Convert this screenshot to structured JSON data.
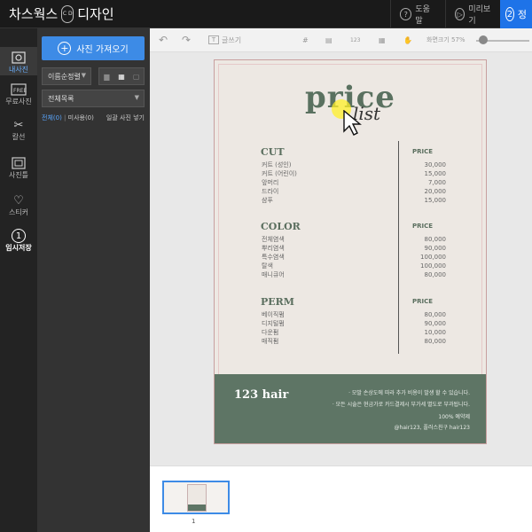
{
  "app": {
    "logo_text": "차스웍스",
    "logo_badge": "C D",
    "logo_suffix": "디자인"
  },
  "topbar": {
    "help_label": "도움말",
    "preview_label": "미리보기",
    "step_number": "2",
    "step_label": "정"
  },
  "rail": {
    "items": [
      {
        "label": "내사진",
        "icon": "photo-icon"
      },
      {
        "label": "무료사진",
        "icon": "free-photo-icon"
      },
      {
        "label": "칼선",
        "icon": "scissors-icon"
      },
      {
        "label": "사진틀",
        "icon": "frame-icon"
      },
      {
        "label": "스티커",
        "icon": "heart-icon"
      },
      {
        "label": "임시저장",
        "icon": "temp-save-icon",
        "number": "1"
      }
    ]
  },
  "panel": {
    "import_button": "사진 가져오기",
    "sort_select": "이름순정렬",
    "folder_select": "전체목록",
    "filter_all": "전체(0)",
    "filter_used": "미사용(0)",
    "filter_bulk": "일괄 사진 넣기"
  },
  "toolbar": {
    "text_tool": "글쓰기",
    "zoom_label": "화면크기 57%",
    "zoom_value": 57
  },
  "document": {
    "title": "price",
    "subtitle": "list",
    "sections": [
      {
        "name": "CUT",
        "price_header": "PRICE",
        "items": [
          {
            "name": "커트 (성인)",
            "price": "30,000"
          },
          {
            "name": "커트 (어린이)",
            "price": "15,000"
          },
          {
            "name": "앞머리",
            "price": "7,000"
          },
          {
            "name": "드라이",
            "price": "20,000"
          },
          {
            "name": "샴푸",
            "price": "15,000"
          }
        ]
      },
      {
        "name": "COLOR",
        "price_header": "PRICE",
        "items": [
          {
            "name": "전체염색",
            "price": "80,000"
          },
          {
            "name": "뿌리염색",
            "price": "90,000"
          },
          {
            "name": "특수염색",
            "price": "100,000"
          },
          {
            "name": "탈색",
            "price": "100,000"
          },
          {
            "name": "매니큐어",
            "price": "80,000"
          }
        ]
      },
      {
        "name": "PERM",
        "price_header": "PRICE",
        "items": [
          {
            "name": "베이직펌",
            "price": "80,000"
          },
          {
            "name": "디지털펌",
            "price": "90,000"
          },
          {
            "name": "다운펌",
            "price": "10,000"
          },
          {
            "name": "매직펌",
            "price": "80,000"
          }
        ]
      }
    ],
    "footer": {
      "brand": "123 hair",
      "note1": "· 모발 손상도에 따라 추가 비용이 발생 할 수 있습니다.",
      "note2": "· 모든 시술은 현금가로 카드결제시 부가세 별도로 부과됩니다.",
      "note3": "100% 예약제",
      "note4": "@hair123, 플러스친구 hair123"
    }
  },
  "thumbnails": {
    "page_number": "1"
  },
  "colors": {
    "accent": "#3d8be6",
    "green": "#5e7565",
    "page_bg": "#ede8e3",
    "border_pink": "#c89f9f"
  }
}
